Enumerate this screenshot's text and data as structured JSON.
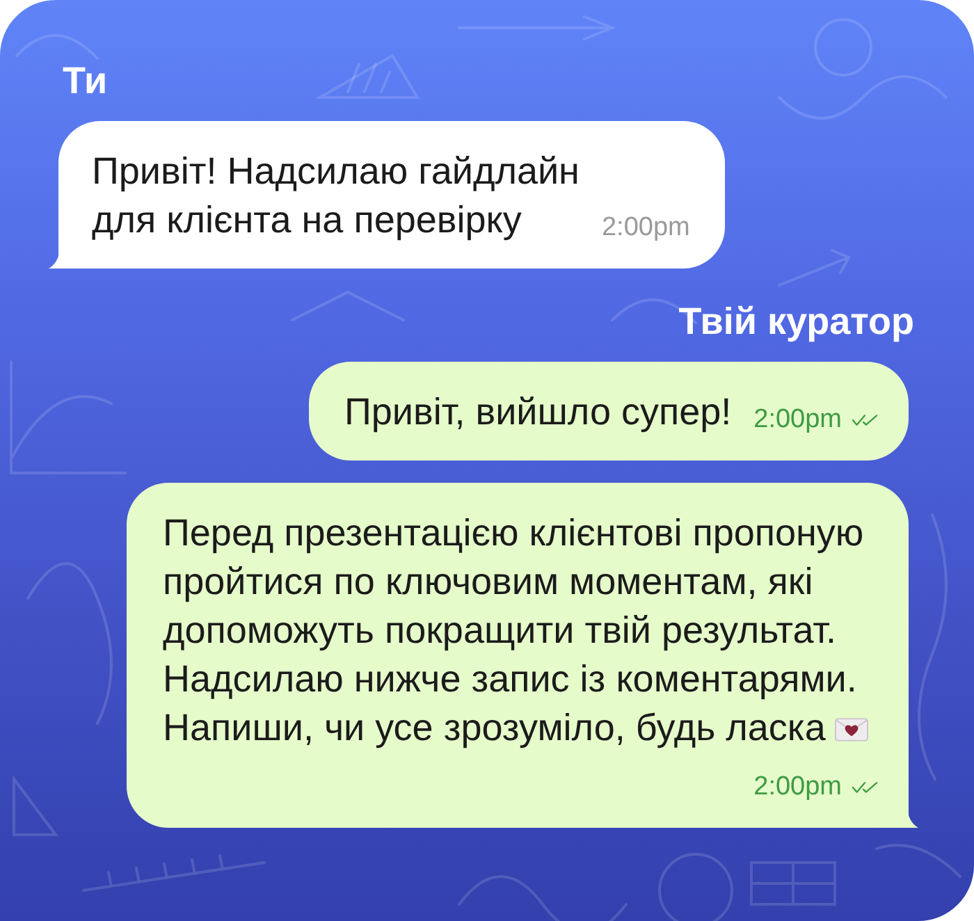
{
  "groups": [
    {
      "sender": "Ти",
      "kind": "incoming",
      "messages": [
        {
          "text": "Привіт! Надсилаю гайдлайн\nдля клієнта на перевірку",
          "time": "2:00pm",
          "read_receipt": false,
          "tail": true,
          "trailing_emoji": false
        }
      ]
    },
    {
      "sender": "Твій куратор",
      "kind": "outgoing",
      "messages": [
        {
          "text": "Привіт, вийшло супер!",
          "time": "2:00pm",
          "read_receipt": true,
          "tail": false,
          "trailing_emoji": false
        },
        {
          "text": "Перед презентацією клієнтові пропоную\nпройтися по ключовим моментам, які\nдопоможуть покращити твій результат.\nНадсилаю нижче запис із коментарями.\nНапиши, чи усе зрозуміло, будь ласка",
          "time": "2:00pm",
          "read_receipt": true,
          "tail": true,
          "trailing_emoji": true
        }
      ]
    }
  ]
}
